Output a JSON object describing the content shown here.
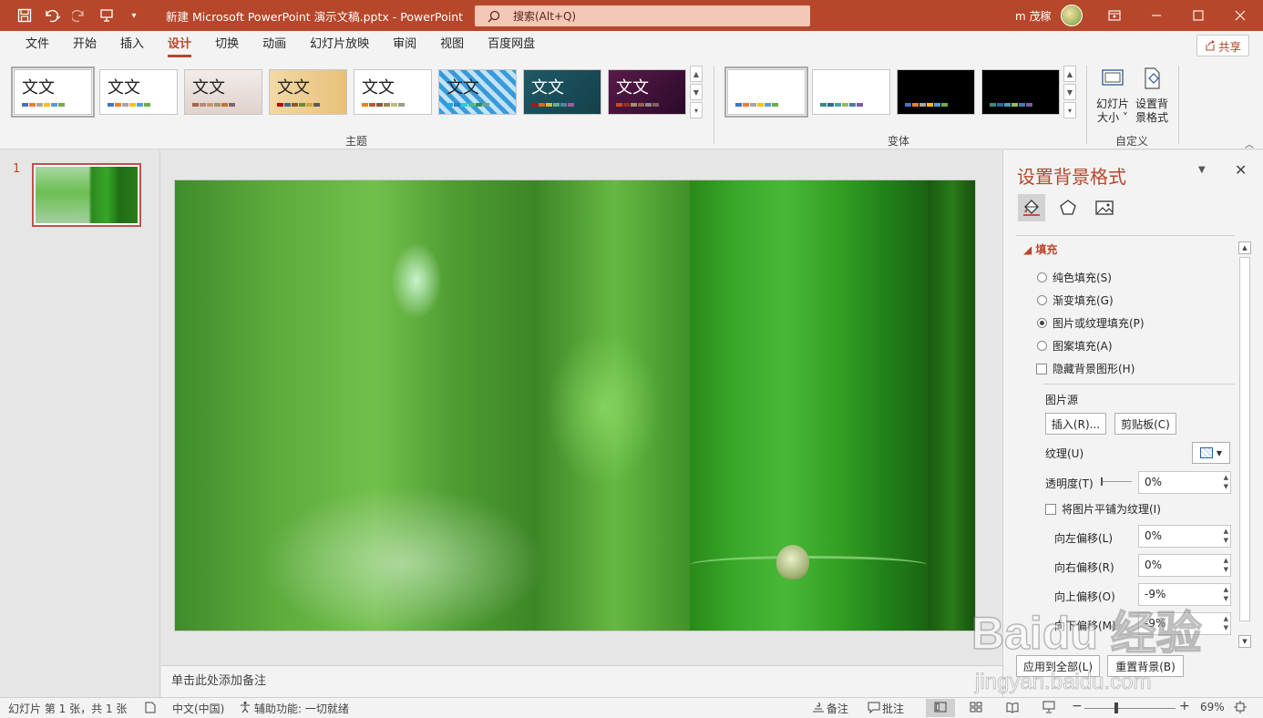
{
  "titlebar": {
    "doc_title": "新建 Microsoft PowerPoint 演示文稿.pptx  -  PowerPoint",
    "search_placeholder": "搜索(Alt+Q)",
    "user_name": "m 茂稼",
    "bg_color": "#b7472a"
  },
  "tabs": [
    "文件",
    "开始",
    "插入",
    "设计",
    "切换",
    "动画",
    "幻灯片放映",
    "审阅",
    "视图",
    "百度网盘"
  ],
  "active_tab": "设计",
  "share_label": "共享",
  "ribbon": {
    "theme_text": "文文",
    "themes_group_label": "主题",
    "variants_group_label": "变体",
    "custom_group_label": "自定义",
    "slide_size_label": "幻灯片大小",
    "slide_size_l1": "幻灯片",
    "slide_size_l2": "大小 ˅",
    "format_bg_l1": "设置背",
    "format_bg_l2": "景格式"
  },
  "thumbnails": {
    "slide_number": "1"
  },
  "notes_placeholder": "单击此处添加备注",
  "pane": {
    "title": "设置背景格式",
    "section_fill": "填充",
    "fill_options": [
      "纯色填充(S)",
      "渐变填充(G)",
      "图片或纹理填充(P)",
      "图案填充(A)"
    ],
    "selected_fill": "图片或纹理填充(P)",
    "hide_bg_graphics": "隐藏背景图形(H)",
    "picture_source": "图片源",
    "insert_button": "插入(R)...",
    "clipboard_button": "剪贴板(C)",
    "texture_label": "纹理(U)",
    "transparency_label": "透明度(T)",
    "transparency_value": "0%",
    "tile_label": "将图片平铺为纹理(I)",
    "offset_left_label": "向左偏移(L)",
    "offset_left_value": "0%",
    "offset_right_label": "向右偏移(R)",
    "offset_right_value": "0%",
    "offset_top_label": "向上偏移(O)",
    "offset_top_value": "-9%",
    "offset_bottom_label": "向下偏移(M)",
    "offset_bottom_value": "-9%",
    "apply_all_button": "应用到全部(L)",
    "reset_button": "重置背景(B)"
  },
  "statusbar": {
    "slide_info": "幻灯片 第 1 张，共 1 张",
    "language": "中文(中国)",
    "accessibility": "辅助功能: 一切就绪",
    "notes_button": "备注",
    "comments_button": "批注",
    "zoom_value": "69%"
  },
  "watermark": {
    "text": "Baidu 经验",
    "url": "jingyan.baidu.com"
  }
}
